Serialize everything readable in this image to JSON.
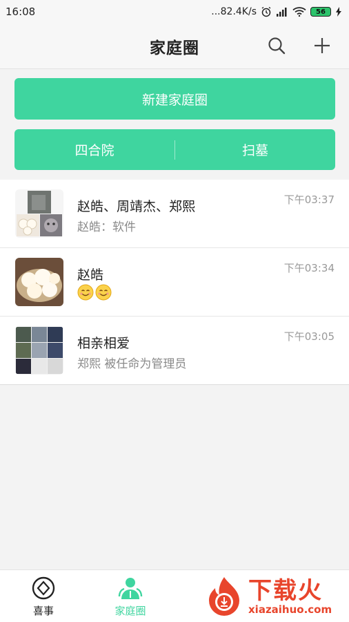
{
  "status_bar": {
    "time": "16:08",
    "network_speed": "...82.4K/s",
    "battery": "56",
    "icons": [
      "alarm-icon",
      "signal-icon",
      "wifi-icon",
      "battery-icon",
      "charging-icon"
    ]
  },
  "header": {
    "title": "家庭圈",
    "icons": [
      "search-icon",
      "plus-icon"
    ]
  },
  "actions": {
    "new_circle": "新建家庭圈",
    "left": "四合院",
    "right": "扫墓"
  },
  "circles": [
    {
      "title": "赵皓、周靖杰、郑熙",
      "subtitle": "赵皓：软件",
      "time": "下午03:37",
      "avatar": "group-collage"
    },
    {
      "title": "赵皓",
      "subtitle": "",
      "emoji": [
        "smiling-face-icon",
        "smiling-face-icon"
      ],
      "time": "下午03:34",
      "avatar": "steamed-buns-photo"
    },
    {
      "title": "相亲相爱",
      "subtitle": "郑熙 被任命为管理员",
      "time": "下午03:05",
      "avatar": "group-collage"
    }
  ],
  "bottom_nav": [
    {
      "label": "喜事",
      "icon": "diamond-icon",
      "active": false
    },
    {
      "label": "家庭圈",
      "icon": "people-icon",
      "active": true
    }
  ],
  "watermark": {
    "cn": "下载火",
    "en": "xiazaihuo.com"
  },
  "colors": {
    "accent": "#3fd59f",
    "watermark": "#e8452c"
  }
}
